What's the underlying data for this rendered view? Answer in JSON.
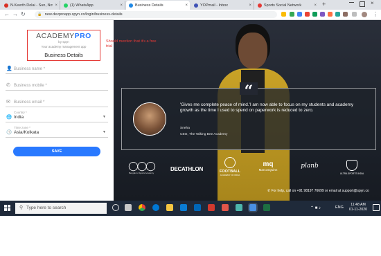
{
  "browser": {
    "tabs": [
      {
        "label": "N.Keerth Dolai - Sun, Novemi",
        "active": false
      },
      {
        "label": "(1) WhatsApp",
        "active": false
      },
      {
        "label": "Business Details",
        "active": true
      },
      {
        "label": "YOPmail - Inbox",
        "active": false
      },
      {
        "label": "Sports Social Network",
        "active": false
      }
    ],
    "new_tab": "+",
    "close_glyph": "×",
    "url": "new.devproapp.spyn.co/login/business-details",
    "colors": {
      "tabbar": "#dee1e6",
      "accent": "#1a73e8"
    }
  },
  "brand": {
    "logo_main": "ACADEMY",
    "logo_accent": "PRO",
    "logo_by": "by spyn",
    "tagline": "Your academy management app",
    "accent_color": "#2979ff"
  },
  "annotation": {
    "note": "Should mention that it's a free trial",
    "color": "#e53935"
  },
  "form": {
    "title": "Business Details",
    "business_name_placeholder": "Business name *",
    "business_mobile_placeholder": "Business mobile *",
    "business_email_placeholder": "Business email *",
    "country_label": "Country *",
    "country_value": "India",
    "timezone_label": "Time zone *",
    "timezone_value": "Asia/Kolkata",
    "save_label": "SAVE"
  },
  "testimonial": {
    "quote": "'Gives me complete peace of mind.'I am now able to focus on my students and academy growth as the time I used to spend on paperwork is reduced to zero.",
    "author": "Sneha",
    "role": "CEO, The Talking Bee Academy"
  },
  "partners": [
    {
      "name": "Bengaluru Sports Academy"
    },
    {
      "name": "DECATHLON"
    },
    {
      "name": "FOOTBALL",
      "sub": "ACADEMY OF INDIA"
    },
    {
      "name": "MarcosQuinn"
    },
    {
      "name": "planb"
    },
    {
      "name": "ULTRA SPORTS INDIA"
    }
  ],
  "help": "For help, call on +91 98197 76699 or email at support@spyn.co",
  "taskbar": {
    "search_placeholder": "Type here to search",
    "language": "ENG",
    "time": "11:48 AM",
    "date": "01-11-2020"
  }
}
